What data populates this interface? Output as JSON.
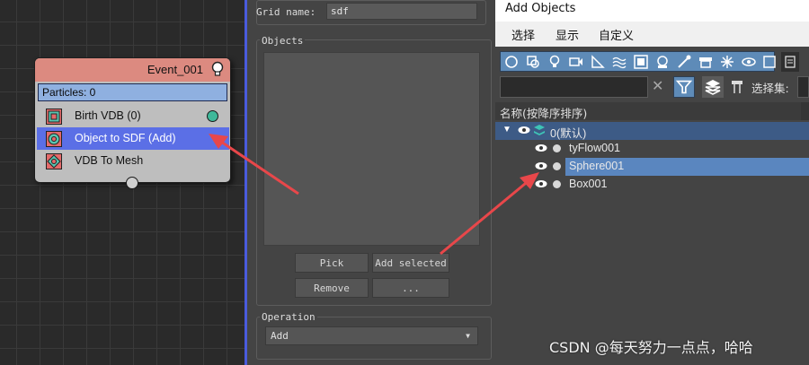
{
  "graph": {
    "node": {
      "title": "Event_001",
      "particles": "Particles: 0",
      "operators": [
        {
          "label": "Birth VDB (0)"
        },
        {
          "label": "Object to SDF (Add)"
        },
        {
          "label": "VDB To Mesh"
        }
      ]
    }
  },
  "params": {
    "grid_name_label": "Grid name:",
    "grid_name_value": "sdf",
    "objects_label": "Objects",
    "pick_button": "Pick",
    "add_selected_button": "Add selected",
    "remove_button": "Remove",
    "more_button": "...",
    "operation_label": "Operation",
    "operation_value": "Add"
  },
  "dialog": {
    "title": "Add Objects",
    "menu": [
      "选择",
      "显示",
      "自定义"
    ],
    "selection_set_label": "选择集:",
    "column_header": "名称(按降序排序)",
    "tree": {
      "layer": "0(默认)",
      "objects": [
        "tyFlow001",
        "Sphere001",
        "Box001"
      ],
      "selected": "Sphere001"
    },
    "colors": {
      "accent": "#5e8bb8",
      "selected_row": "#5a86bf",
      "layer_row": "#3d5b86",
      "arrow": "#e8474a"
    }
  },
  "watermark": "CSDN @每天努力一点点，哈哈"
}
